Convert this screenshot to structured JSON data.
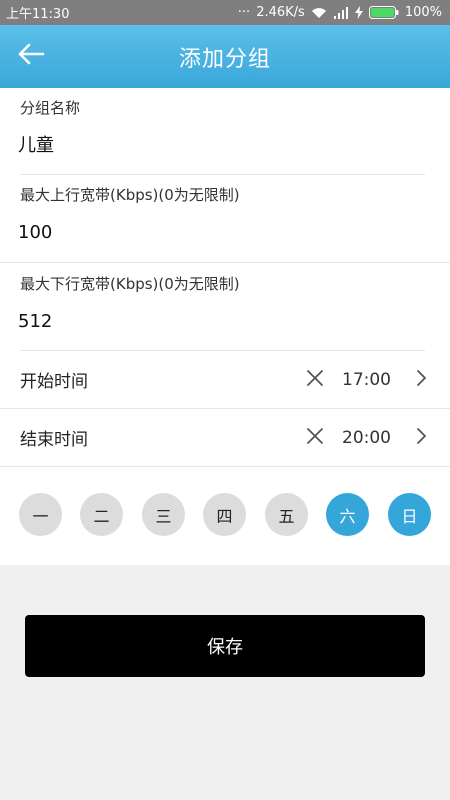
{
  "status_bar": {
    "time": "上午11:30",
    "dots": "···",
    "network_speed": "2.46K/s",
    "battery": "100%"
  },
  "header": {
    "title": "添加分组",
    "back_icon": "arrow-left-icon"
  },
  "form": {
    "group_name": {
      "label": "分组名称",
      "value": "儿童"
    },
    "upload_bandwidth": {
      "label": "最大上行宽带(Kbps)(0为无限制)",
      "value": "100"
    },
    "download_bandwidth": {
      "label": "最大下行宽带(Kbps)(0为无限制)",
      "value": "512"
    },
    "start_time": {
      "label": "开始时间",
      "value": "17:00"
    },
    "end_time": {
      "label": "结束时间",
      "value": "20:00"
    }
  },
  "weekdays": [
    {
      "label": "一",
      "selected": false
    },
    {
      "label": "二",
      "selected": false
    },
    {
      "label": "三",
      "selected": false
    },
    {
      "label": "四",
      "selected": false
    },
    {
      "label": "五",
      "selected": false
    },
    {
      "label": "六",
      "selected": true
    },
    {
      "label": "日",
      "selected": true
    }
  ],
  "save_label": "保存",
  "colors": {
    "accent": "#34a6da",
    "header_top": "#5bbfe9",
    "day_inactive": "#dcdcdc",
    "save_button": "#000000"
  }
}
